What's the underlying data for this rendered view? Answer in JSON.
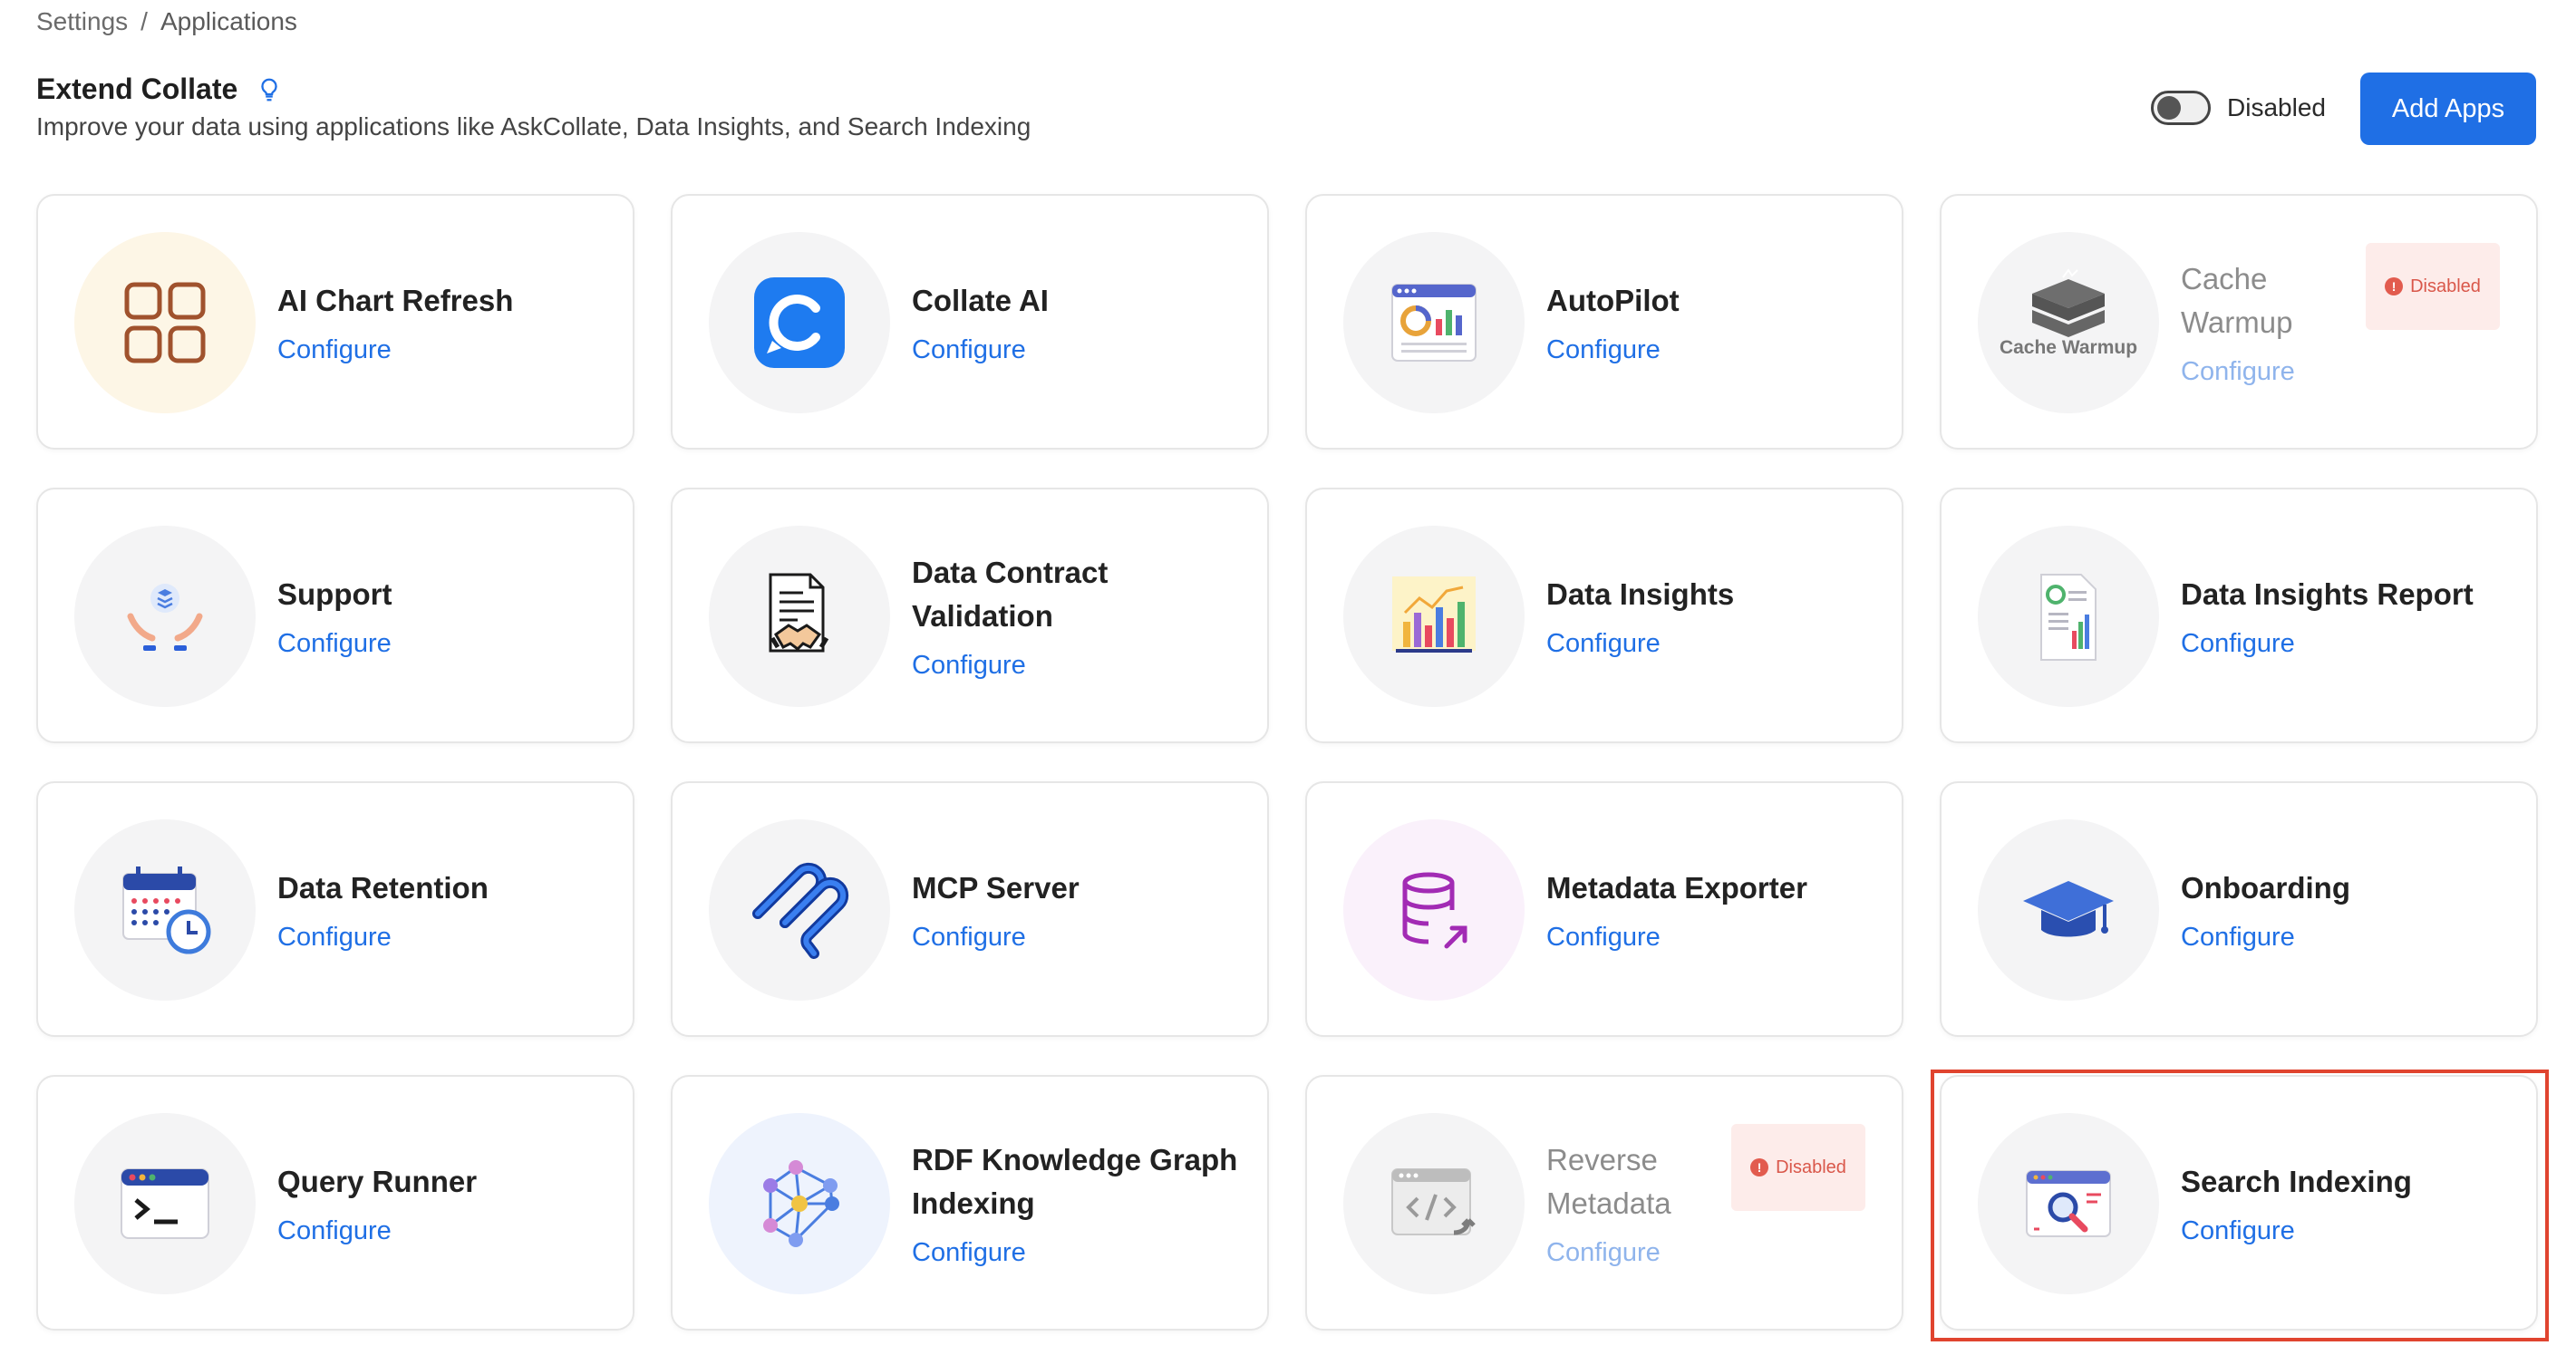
{
  "breadcrumb": {
    "root": "Settings",
    "separator": "/",
    "current": "Applications"
  },
  "header": {
    "title": "Extend Collate",
    "subtitle": "Improve your data using applications like AskCollate, Data Insights, and Search Indexing",
    "toggle_label": "Disabled",
    "add_button": "Add Apps"
  },
  "apps": [
    {
      "name": "AI Chart Refresh",
      "link": "Configure",
      "icon": "grid-icon"
    },
    {
      "name": "Collate AI",
      "link": "Configure",
      "icon": "collate-ai-icon"
    },
    {
      "name": "AutoPilot",
      "link": "Configure",
      "icon": "dashboard-icon"
    },
    {
      "name": "Cache Warmup",
      "link": "Configure",
      "icon": "cache-warmup-icon",
      "icon_label": "Cache Warmup",
      "badge": "Disabled"
    },
    {
      "name": "Support",
      "link": "Configure",
      "icon": "support-hands-icon"
    },
    {
      "name": "Data Contract Validation",
      "link": "Configure",
      "icon": "contract-handshake-icon"
    },
    {
      "name": "Data Insights",
      "link": "Configure",
      "icon": "bar-chart-icon"
    },
    {
      "name": "Data Insights Report",
      "link": "Configure",
      "icon": "report-icon"
    },
    {
      "name": "Data Retention",
      "link": "Configure",
      "icon": "calendar-clock-icon"
    },
    {
      "name": "MCP Server",
      "link": "Configure",
      "icon": "mcp-icon"
    },
    {
      "name": "Metadata Exporter",
      "link": "Configure",
      "icon": "database-export-icon"
    },
    {
      "name": "Onboarding",
      "link": "Configure",
      "icon": "graduation-cap-icon"
    },
    {
      "name": "Query Runner",
      "link": "Configure",
      "icon": "terminal-icon"
    },
    {
      "name": "RDF Knowledge Graph Indexing",
      "link": "Configure",
      "icon": "knowledge-graph-icon"
    },
    {
      "name": "Reverse Metadata",
      "link": "Configure",
      "icon": "code-window-icon",
      "badge": "Disabled"
    },
    {
      "name": "Search Indexing",
      "link": "Configure",
      "icon": "search-window-icon"
    }
  ],
  "colors": {
    "accent": "#1f6fe5",
    "highlight": "#e0442f",
    "badge_bg": "#fdecea",
    "badge_text": "#d9574a"
  }
}
